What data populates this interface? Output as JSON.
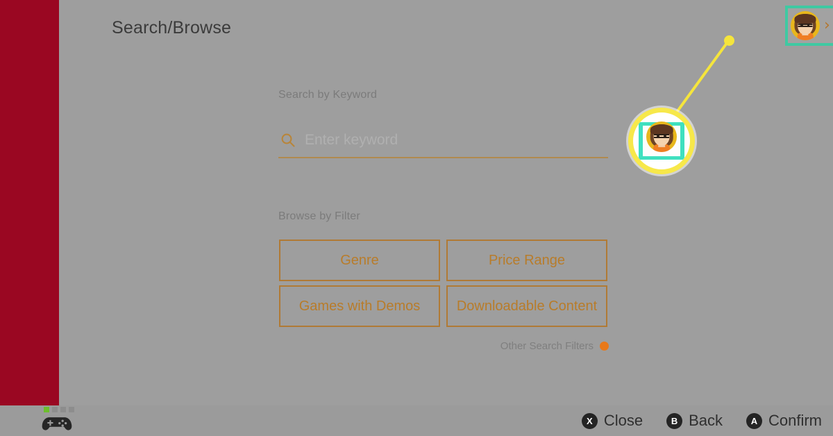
{
  "window": {
    "title": "Search/Browse",
    "background_color": "#9e9e9e",
    "rail_color": "#9a0722"
  },
  "header": {
    "title": "Search/Browse",
    "account": {
      "avatar_name": "mii-avatar",
      "chevron": "›",
      "highlight_color": "#3fc9a2"
    }
  },
  "main": {
    "keyword_section": {
      "label": "Search by Keyword",
      "search_icon": "search-icon",
      "input_value": "",
      "input_placeholder": "Enter keyword",
      "underline_color": "#b08a4e"
    },
    "filter_section": {
      "label": "Browse by Filter",
      "buttons": [
        {
          "label": "Genre"
        },
        {
          "label": "Price Range"
        },
        {
          "label": "Games with Demos"
        },
        {
          "label": "Downloadable Content"
        }
      ],
      "accent_color": "#b87c2a"
    },
    "other_filters": {
      "label": "Other Search Filters",
      "badge_icon": "orange-dot-icon",
      "badge_color": "#e8791a"
    }
  },
  "bottom_bar": {
    "controller": {
      "icon": "gamepad-icon",
      "player_pips": [
        true,
        false,
        false,
        false
      ],
      "active_color": "#6cbe2d"
    },
    "hints": [
      {
        "button": "X",
        "label": "Close"
      },
      {
        "button": "B",
        "label": "Back"
      },
      {
        "button": "A",
        "label": "Confirm"
      }
    ]
  },
  "annotation": {
    "type": "magnifier-callout",
    "target": "account-avatar",
    "line_color": "#f5e53c",
    "ring_color": "#f7e84a",
    "inner_highlight_color": "#3fe0bf"
  }
}
